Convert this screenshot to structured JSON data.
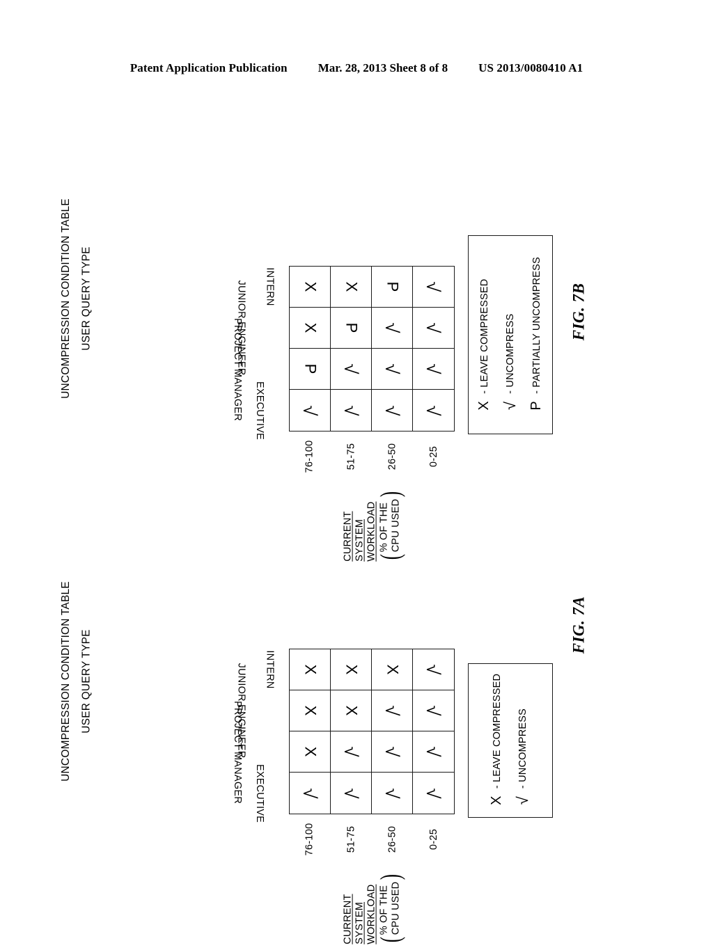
{
  "header": {
    "publication": "Patent Application Publication",
    "date_sheet": "Mar. 28, 2013  Sheet 8 of 8",
    "patent_number": "US 2013/0080410 A1"
  },
  "labels": {
    "table_title": "UNCOMPRESSION CONDITION TABLE",
    "column_group_title": "USER QUERY TYPE",
    "axis_line1": "CURRENT",
    "axis_line2": "SYSTEM",
    "axis_line3": "WORKLOAD",
    "axis_paren_line1": "% OF THE",
    "axis_paren_line2": "CPU USED",
    "paren_open": "(",
    "paren_close": ")"
  },
  "query_types": [
    "EXECUTIVE",
    "PROJECT MANAGER",
    "JUNIOR ENGINEER",
    "INTERN"
  ],
  "workload_ranges": [
    "76-100",
    "51-75",
    "26-50",
    "0-25"
  ],
  "symbols": {
    "leave_compressed": "X",
    "uncompress": "√",
    "partially_uncompress": "P"
  },
  "figures": [
    {
      "id": "7b",
      "fig_label": "FIG. 7B",
      "matrix": [
        [
          "X",
          "X",
          "P",
          "√"
        ],
        [
          "X",
          "P",
          "√",
          "√"
        ],
        [
          "P",
          "√",
          "√",
          "√"
        ],
        [
          "√",
          "√",
          "√",
          "√"
        ]
      ],
      "legend": [
        {
          "symbol": "X",
          "text": "- LEAVE COMPRESSED"
        },
        {
          "symbol": "√",
          "text": "- UNCOMPRESS"
        },
        {
          "symbol": "P",
          "text": "- PARTIALLY UNCOMPRESS"
        }
      ]
    },
    {
      "id": "7a",
      "fig_label": "FIG. 7A",
      "matrix": [
        [
          "X",
          "X",
          "X",
          "√"
        ],
        [
          "X",
          "X",
          "√",
          "√"
        ],
        [
          "X",
          "√",
          "√",
          "√"
        ],
        [
          "√",
          "√",
          "√",
          "√"
        ]
      ],
      "legend": [
        {
          "symbol": "X",
          "text": "- LEAVE COMPRESSED"
        },
        {
          "symbol": "√",
          "text": "- UNCOMPRESS"
        }
      ]
    }
  ],
  "chart_data": {
    "type": "table",
    "title": "UNCOMPRESSION CONDITION TABLE",
    "xlabel": "CURRENT SYSTEM WORKLOAD (% OF THE CPU USED)",
    "ylabel": "USER QUERY TYPE",
    "columns": [
      "76-100",
      "51-75",
      "26-50",
      "0-25"
    ],
    "rows": [
      "INTERN",
      "JUNIOR ENGINEER",
      "PROJECT MANAGER",
      "EXECUTIVE"
    ],
    "tables": [
      {
        "name": "FIG. 7B",
        "cells": [
          [
            "X",
            "X",
            "P",
            "√"
          ],
          [
            "X",
            "P",
            "√",
            "√"
          ],
          [
            "P",
            "√",
            "√",
            "√"
          ],
          [
            "√",
            "√",
            "√",
            "√"
          ]
        ]
      },
      {
        "name": "FIG. 7A",
        "cells": [
          [
            "X",
            "X",
            "X",
            "√"
          ],
          [
            "X",
            "X",
            "√",
            "√"
          ],
          [
            "X",
            "√",
            "√",
            "√"
          ],
          [
            "√",
            "√",
            "√",
            "√"
          ]
        ]
      }
    ]
  }
}
